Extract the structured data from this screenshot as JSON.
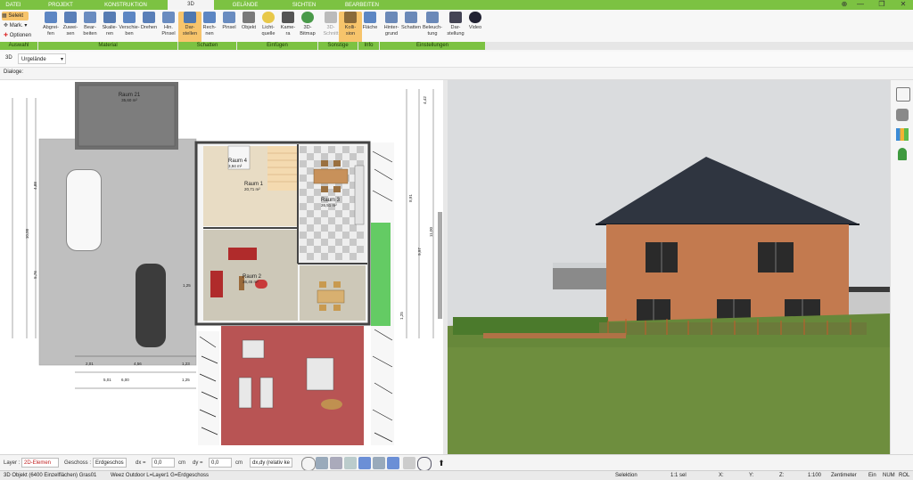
{
  "tabs": [
    {
      "label": "DATEI"
    },
    {
      "label": "PROJEKT"
    },
    {
      "label": "KONSTRUKTION"
    },
    {
      "label": "3D"
    },
    {
      "label": "GELÄNDE"
    },
    {
      "label": "SICHTEN"
    },
    {
      "label": "BEARBEITEN"
    }
  ],
  "window": {
    "minimize": "—",
    "restore": "❐",
    "close": "✕"
  },
  "selection": {
    "selekt": "Selekt",
    "mark": "Mark.",
    "optionen": "Optionen"
  },
  "ribbon": {
    "material": [
      {
        "label1": "Abgrei-",
        "label2": "fen"
      },
      {
        "label1": "Zuwei-",
        "label2": "sen"
      },
      {
        "label1": "Bear-",
        "label2": "beiten"
      },
      {
        "label1": "Skalie-",
        "label2": "ren"
      },
      {
        "label1": "Verschie-",
        "label2": "ben"
      },
      {
        "label1": "Drehen",
        "label2": ""
      },
      {
        "label1": "Hin.",
        "label2": "Pinsel"
      }
    ],
    "schatten": [
      {
        "label1": "Dar-",
        "label2": "stellen"
      },
      {
        "label1": "Rech-",
        "label2": "nen"
      },
      {
        "label1": "Pinsel",
        "label2": ""
      }
    ],
    "einfuegen": [
      {
        "label1": "Objekt",
        "label2": ""
      },
      {
        "label1": "Licht-",
        "label2": "quelle"
      },
      {
        "label1": "Kame-",
        "label2": "ra"
      },
      {
        "label1": "3D-",
        "label2": "Bitmap"
      }
    ],
    "sonstige": [
      {
        "label1": "3D-",
        "label2": "Schnitt"
      },
      {
        "label1": "Kolli-",
        "label2": "sion"
      }
    ],
    "info": [
      {
        "label1": "Fläche",
        "label2": ""
      }
    ],
    "einstellungen": [
      {
        "label1": "Hinter-",
        "label2": "grund"
      },
      {
        "label1": "Schatten",
        "label2": ""
      },
      {
        "label1": "Beleuch-",
        "label2": "tung"
      },
      {
        "label1": "Dar-",
        "label2": "stellung"
      },
      {
        "label1": "Video",
        "label2": ""
      }
    ]
  },
  "groups": {
    "auswahl": "Auswahl",
    "material": "Material",
    "schatten": "Schatten",
    "einfuegen": "Einfügen",
    "sonstige": "Sonstige",
    "info": "Info",
    "einstellungen": "Einstellungen"
  },
  "toolbar2": {
    "mode": "3D",
    "terrain": "Urgelände"
  },
  "dialog": {
    "label": "Dialoge:"
  },
  "plan": {
    "rooms": [
      {
        "name": "Raum 21",
        "area": "35,60 m²"
      },
      {
        "name": "Raum 4",
        "area": "3,94 m²"
      },
      {
        "name": "Raum 1",
        "area": "20,71 m²"
      },
      {
        "name": "Raum 3",
        "area": "26,51 m²"
      },
      {
        "name": "Raum 2",
        "area": "36,45 m²"
      }
    ],
    "dims_left": [
      "10,00",
      "4,88",
      "5,76",
      "1,25"
    ],
    "dims_bottom": [
      "2,01",
      "4,56",
      "1,23",
      "6,00",
      "1,25",
      "5,01"
    ],
    "dims_right": [
      "4,42",
      "8,91",
      "9,97",
      "11,00",
      "1,25"
    ]
  },
  "layerbar": {
    "layer_label": "Layer :",
    "layer_value": "2D-Elemen",
    "geschoss_label": "Geschoss :",
    "geschoss_value": "Erdgeschos",
    "dx_label": "dx =",
    "dx_value": "0,0",
    "dx_unit": "cm",
    "dy_label": "dy =",
    "dy_value": "0,0",
    "dy_unit": "cm",
    "mode_value": "dx,dy (relativ ke"
  },
  "status": {
    "left": "3D Objekt (6400 Einzelflächen) Gras01",
    "middle": "Weez Outdoor L=Layer1 G=Erdgeschoss",
    "selektion": "Selektion",
    "scale": "1:1 sel",
    "x": "X:",
    "y": "Y:",
    "z": "Z:",
    "ratio": "1:100",
    "unit": "Zentimeter",
    "ein": "Ein",
    "num": "NUM",
    "rol": "ROL"
  },
  "colors": {
    "accent": "#7cc242",
    "active_button": "#f7c46b"
  }
}
